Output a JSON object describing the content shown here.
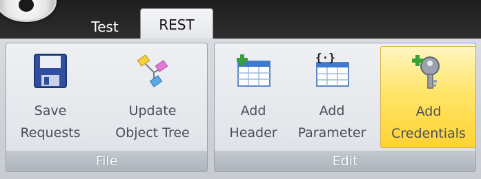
{
  "tabs": [
    {
      "label": "Test"
    },
    {
      "label": "REST",
      "active": true
    }
  ],
  "ribbon": {
    "groups": [
      {
        "caption": "File",
        "buttons": [
          {
            "label": "Save\nRequests",
            "icon": "floppy-disk-icon"
          },
          {
            "label": "Update\nObject Tree",
            "icon": "object-tree-icon"
          }
        ]
      },
      {
        "caption": "Edit",
        "buttons": [
          {
            "label": "Add\nHeader",
            "icon": "add-header-icon"
          },
          {
            "label": "Add\nParameter",
            "icon": "add-parameter-icon"
          },
          {
            "label": "Add\nCredentials",
            "icon": "add-credentials-key-icon",
            "highlighted": true
          }
        ]
      }
    ]
  },
  "colors": {
    "tab_strip": "#262626",
    "highlight": "#ffd93c",
    "caption_text": "#ffffff"
  }
}
